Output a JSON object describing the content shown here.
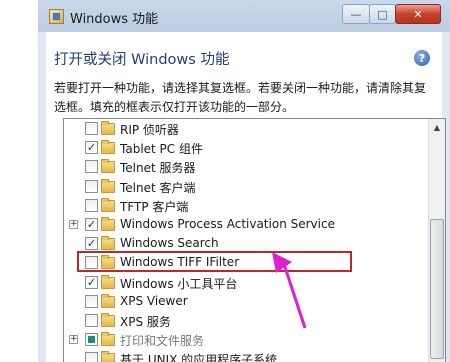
{
  "window": {
    "title": "Windows 功能",
    "controls": {
      "minimize": "—",
      "maximize": "□",
      "close": "✕"
    }
  },
  "header": {
    "heading": "打开或关闭 Windows 功能",
    "help_icon": "?",
    "description": "若要打开一种功能，请选择其复选框。若要关闭一种功能，请清除其复选框。填充的框表示仅打开该功能的一部分。"
  },
  "features": [
    {
      "label": "RIP 侦听器",
      "state": "unchecked",
      "expandable": false
    },
    {
      "label": "Tablet PC 组件",
      "state": "checked",
      "expandable": false
    },
    {
      "label": "Telnet 服务器",
      "state": "unchecked",
      "expandable": false
    },
    {
      "label": "Telnet 客户端",
      "state": "unchecked",
      "expandable": false
    },
    {
      "label": "TFTP 客户端",
      "state": "unchecked",
      "expandable": false
    },
    {
      "label": "Windows Process Activation Service",
      "state": "checked",
      "expandable": true
    },
    {
      "label": "Windows Search",
      "state": "checked",
      "expandable": false
    },
    {
      "label": "Windows TIFF IFilter",
      "state": "unchecked",
      "expandable": false
    },
    {
      "label": "Windows 小工具平台",
      "state": "checked",
      "expandable": false
    },
    {
      "label": "XPS Viewer",
      "state": "unchecked",
      "expandable": false
    },
    {
      "label": "XPS 服务",
      "state": "unchecked",
      "expandable": false
    },
    {
      "label": "打印和文件服务",
      "state": "partial",
      "expandable": true
    },
    {
      "label": "基于 UNIX 的应用程序子系统",
      "state": "unchecked",
      "expandable": false
    }
  ],
  "symbols": {
    "checked": "✓",
    "expand": "+",
    "scroll_up": "▲"
  },
  "colors": {
    "highlight_box": "#c0272d",
    "annotation_arrow": "#e01fcf",
    "heading": "#1e3f7a"
  }
}
